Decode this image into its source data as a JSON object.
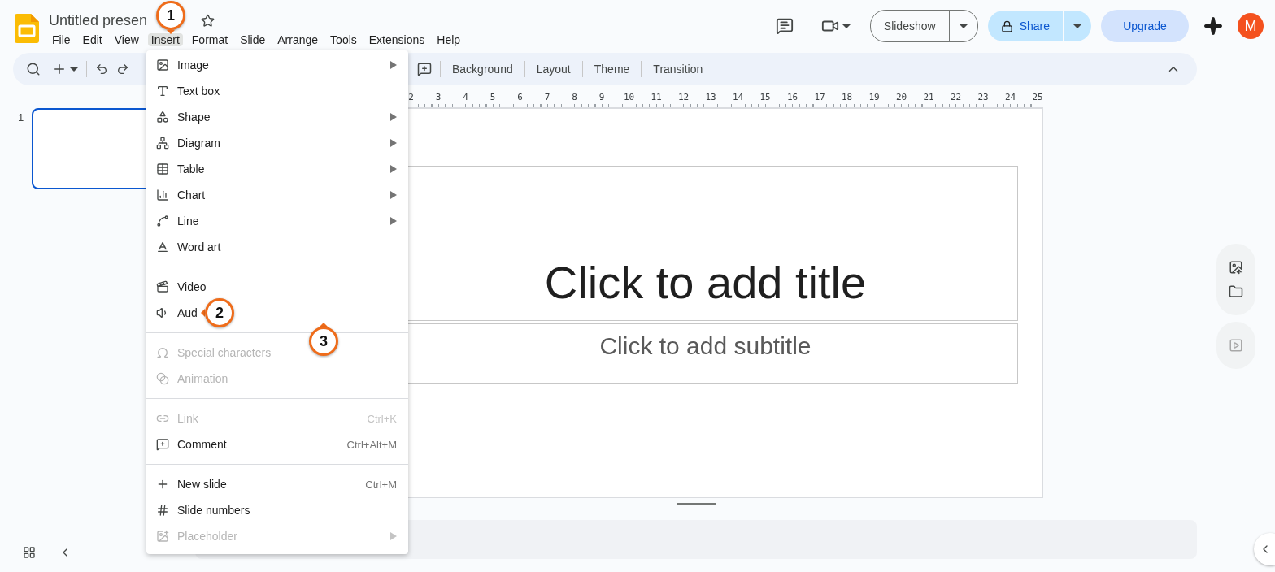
{
  "title": "Untitled presen",
  "menubar": [
    {
      "label": "File",
      "selected": false
    },
    {
      "label": "Edit",
      "selected": false
    },
    {
      "label": "View",
      "selected": false
    },
    {
      "label": "Insert",
      "selected": true
    },
    {
      "label": "Format",
      "selected": false
    },
    {
      "label": "Slide",
      "selected": false
    },
    {
      "label": "Arrange",
      "selected": false
    },
    {
      "label": "Tools",
      "selected": false
    },
    {
      "label": "Extensions",
      "selected": false
    },
    {
      "label": "Help",
      "selected": false
    }
  ],
  "header_buttons": {
    "slideshow": "Slideshow",
    "share": "Share",
    "upgrade": "Upgrade",
    "avatar": "M"
  },
  "toolbar": {
    "buttons": [
      "Background",
      "Layout",
      "Theme",
      "Transition"
    ]
  },
  "ruler": [
    "2",
    "3",
    "4",
    "5",
    "6",
    "7",
    "8",
    "9",
    "10",
    "11",
    "12",
    "13",
    "14",
    "15",
    "16",
    "17",
    "18",
    "19",
    "20",
    "21",
    "22",
    "23",
    "24",
    "25"
  ],
  "filmstrip": {
    "slide_number": "1",
    "selected": true
  },
  "slide": {
    "title_placeholder": "Click to add title",
    "subtitle_placeholder": "Click to add subtitle"
  },
  "insert_menu": {
    "sections": [
      [
        {
          "label": "Image",
          "submenu": true,
          "disabled": false
        },
        {
          "label": "Text box",
          "submenu": false,
          "disabled": false
        },
        {
          "label": "Shape",
          "submenu": true,
          "disabled": false
        },
        {
          "label": "Diagram",
          "submenu": true,
          "disabled": false
        },
        {
          "label": "Table",
          "submenu": true,
          "disabled": false
        },
        {
          "label": "Chart",
          "submenu": true,
          "disabled": false
        },
        {
          "label": "Line",
          "submenu": true,
          "disabled": false
        },
        {
          "label": "Word art",
          "submenu": false,
          "disabled": false
        }
      ],
      [
        {
          "label": "Video",
          "submenu": false,
          "disabled": false
        },
        {
          "label": "Aud",
          "submenu": false,
          "disabled": false
        }
      ],
      [
        {
          "label": "Special characters",
          "submenu": false,
          "disabled": true
        },
        {
          "label": "Animation",
          "submenu": false,
          "disabled": true
        }
      ],
      [
        {
          "label": "Link",
          "shortcut": "Ctrl+K",
          "submenu": false,
          "disabled": true
        },
        {
          "label": "Comment",
          "shortcut": "Ctrl+Alt+M",
          "submenu": false,
          "disabled": false
        }
      ],
      [
        {
          "label": "New slide",
          "shortcut": "Ctrl+M",
          "submenu": false,
          "disabled": false
        },
        {
          "label": "Slide numbers",
          "submenu": false,
          "disabled": false
        },
        {
          "label": "Placeholder",
          "submenu": true,
          "disabled": true
        }
      ]
    ]
  },
  "callouts": [
    {
      "label": "1"
    },
    {
      "label": "2"
    },
    {
      "label": "3"
    }
  ]
}
